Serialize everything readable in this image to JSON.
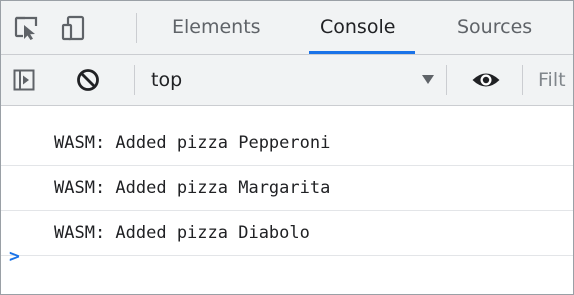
{
  "tabs": {
    "items": [
      {
        "label": "Elements"
      },
      {
        "label": "Console"
      },
      {
        "label": "Sources"
      }
    ],
    "active": "Console"
  },
  "toolbar": {
    "context": "top",
    "filter_placeholder": "Filt"
  },
  "console": {
    "messages": [
      {
        "text": "WASM: Added pizza Pepperoni"
      },
      {
        "text": "WASM: Added pizza Margarita"
      },
      {
        "text": "WASM: Added pizza Diabolo"
      }
    ],
    "prompt": ">"
  },
  "colors": {
    "accent": "#1a73e8",
    "toolbar_bg": "#f1f3f4",
    "text": "#202124",
    "muted": "#5f6368"
  },
  "icons": [
    "inspect-element-icon",
    "device-toolbar-icon",
    "sidebar-toggle-icon",
    "clear-console-icon",
    "dropdown-caret-icon",
    "eye-icon"
  ]
}
